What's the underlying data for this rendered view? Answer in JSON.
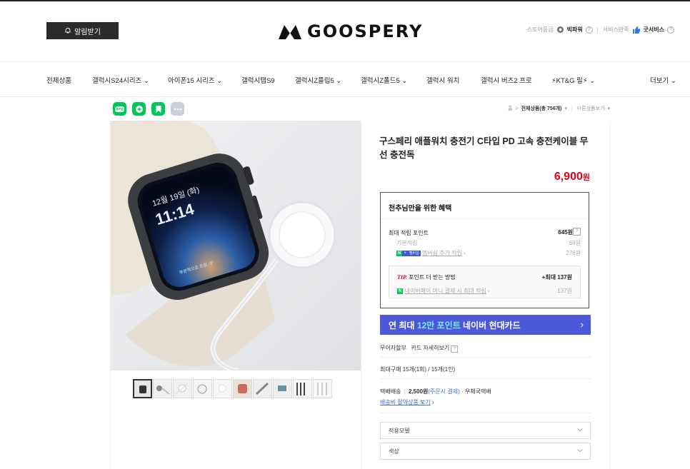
{
  "header": {
    "notify_label": "알림받기",
    "logo_text": "GOOSPERY",
    "store_grade_label": "스토어등급",
    "store_grade_value": "빅파워",
    "service_label": "서비스만족",
    "service_value": "굿서비스"
  },
  "nav": {
    "items": [
      {
        "label": "전체상품"
      },
      {
        "label": "갤럭시S24시리즈 ⌄"
      },
      {
        "label": "아이폰15 시리즈 ⌄"
      },
      {
        "label": "갤럭시탭S9"
      },
      {
        "label": "갤럭시Z플립5 ⌄"
      },
      {
        "label": "갤럭시Z폴드5 ⌄"
      },
      {
        "label": "갤럭시 워치"
      },
      {
        "label": "갤럭시 버즈2 프로"
      },
      {
        "label": "⚡KT&G 릴⚡ ⌄"
      }
    ],
    "more_label": "더보기 ⌄"
  },
  "share": {
    "items": [
      "blog-share",
      "talk-share",
      "bookmark-share",
      "more-share"
    ],
    "blog_text": "blog"
  },
  "breadcrumb": {
    "home": "홈",
    "current": "전체상품(총 756개)",
    "other": "다른상품보기"
  },
  "product": {
    "title": "구스페리 애플워치 충전기 C타입 PD 고속 충전케이블 무선 충전독",
    "price": "6,900",
    "price_unit": "원",
    "watch_date": "12월 19일 (화)",
    "watch_time": "11:14",
    "watch_sub": "부분적으로 흐림 -3°"
  },
  "benefit": {
    "heading": "천추님만을 위한 혜택",
    "max_points_label": "최대 적립 포인트",
    "max_points_value": "645원",
    "basic_label": "기본적립",
    "basic_value": "69원",
    "membership_label": "멤버십 추가 적립",
    "membership_value": "276원",
    "n_badge": "N",
    "plus_badge": "+",
    "mem_badge": "멤버십",
    "tip_prefix": "TIP.",
    "tip_label": "포인트 더 받는 방법",
    "tip_value": "+최대 137원",
    "pay_label": "네이버페이 머니 결제 시 최대 적립",
    "pay_value": "137원",
    "pay_badge": "N"
  },
  "card_banner": {
    "prefix": "연 최대",
    "highlight": "12만 포인트",
    "suffix": "네이버 현대카드",
    "arrow": "›"
  },
  "installment": {
    "label": "무이자할부",
    "detail": "카드 자세히보기"
  },
  "max_purchase": "최대구매 15개(1회) / 15개(1인)",
  "shipping": {
    "label": "택배배송",
    "fee": "2,500원",
    "fee_note": "(주문시 결제)",
    "carrier": "· 우체국택배",
    "saving_link": "배송비 절약상품 보기"
  },
  "options": [
    {
      "placeholder": "적용모델"
    },
    {
      "placeholder": "색상"
    }
  ],
  "colors": {
    "price_red": "#e3001f",
    "banner_blue": "#4b58d8",
    "naver_green": "#03c75a"
  }
}
